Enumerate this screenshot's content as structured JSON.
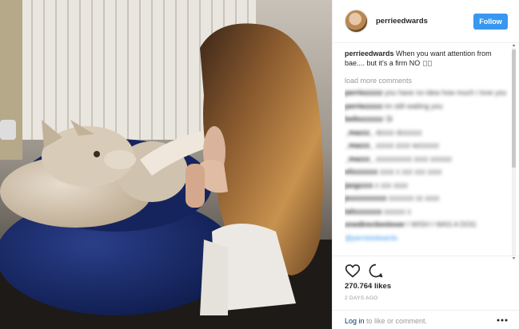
{
  "post": {
    "username": "perrieedwards",
    "follow_label": "Follow",
    "caption_user": "perrieedwards",
    "caption_text": "When you want attention from bae.... but it's a firm NO"
  },
  "comments": {
    "load_more": "load more comments",
    "items": [
      {
        "user": "perriezzzzz",
        "text": "you have no idea how much i love you"
      },
      {
        "user": "perriezzzzz",
        "text": "im still waiting you"
      },
      {
        "user": "bellozzzzzz",
        "text": "😘"
      },
      {
        "user": "_mazzz_",
        "text": "dzzzz dzzzzzz"
      },
      {
        "user": "_mazzz_",
        "text": "zzzzz zzzz wzzzzzz"
      },
      {
        "user": "_mazzz_",
        "text": "zzzzzzzzzz zzzz zzzzzz"
      },
      {
        "user": "elizzzzzzz",
        "text": "zzzz z zzz zzz zzzz"
      },
      {
        "user": "jazgzzzz",
        "text": "z zzz zzzz"
      },
      {
        "user": "jezzzzzzzzzz",
        "text": "zzzzzzz zz zzzz"
      },
      {
        "user": "lafzzzzzzzz",
        "text": "zzzzzz z"
      },
      {
        "user": "onedirectionlover",
        "text": "I WISH I WAS A DOG"
      },
      {
        "user": "",
        "text": "@perrieedwards"
      }
    ]
  },
  "actions": {
    "heart_icon": "heart-icon",
    "comment_icon": "comment-icon",
    "likes": "270.764 likes",
    "time": "2 DAYS AGO"
  },
  "login": {
    "link": "Log in",
    "rest": " to like or comment."
  },
  "colors": {
    "follow_blue": "#3897f0",
    "link_navy": "#003569"
  }
}
